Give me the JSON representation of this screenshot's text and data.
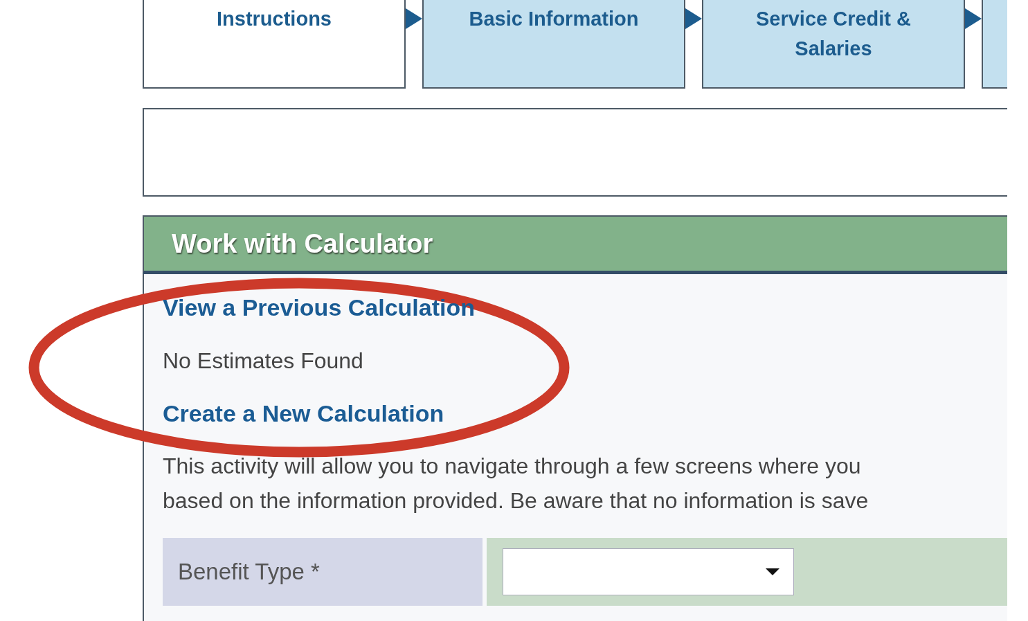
{
  "tabs": [
    {
      "label": "Instructions",
      "selected": true
    },
    {
      "label": "Basic Information",
      "selected": false
    },
    {
      "label": "Service Credit & Salaries",
      "selected": false
    },
    {
      "selected": false
    }
  ],
  "section": {
    "title": "Work with Calculator",
    "previous_link": "View a Previous Calculation",
    "previous_status": "No Estimates Found",
    "new_link": "Create a New Calculation",
    "description_lines": [
      "This activity will allow you to navigate through a few screens where you",
      "based on the information provided. Be aware that no information is save"
    ],
    "fields": [
      {
        "label": "Benefit Type *",
        "kind": "dropdown"
      }
    ]
  },
  "annotation": {
    "kind": "ellipse",
    "color": "#cc3a2a"
  }
}
